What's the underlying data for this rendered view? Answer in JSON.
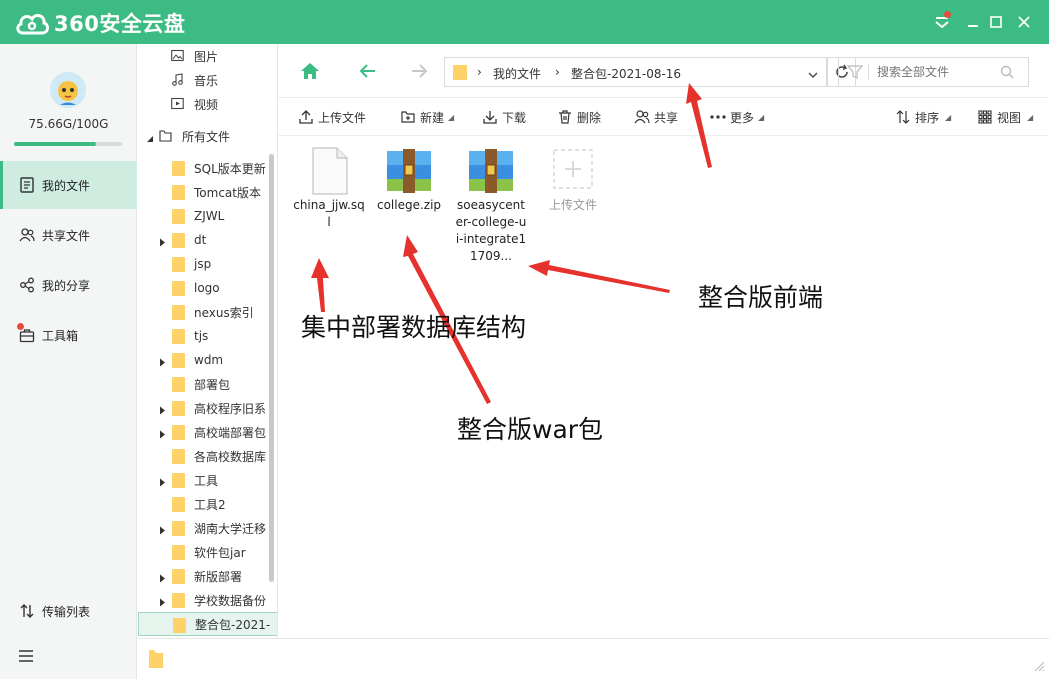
{
  "app": {
    "title": "360安全云盘"
  },
  "window_controls": {
    "menu": "menu-icon",
    "minimize": "minimize-icon",
    "maximize": "maximize-icon",
    "close": "close-icon"
  },
  "user": {
    "quota_text": "75.66G/100G",
    "quota_fraction": 0.7566
  },
  "nav": {
    "items": [
      {
        "label": "我的文件",
        "icon": "file-icon"
      },
      {
        "label": "共享文件",
        "icon": "people-icon"
      },
      {
        "label": "我的分享",
        "icon": "share-icon"
      },
      {
        "label": "工具箱",
        "icon": "toolbox-icon"
      }
    ],
    "transfer_label": "传输列表",
    "menu_icon": "hamburger-icon"
  },
  "tree": {
    "top_items": [
      {
        "label": "图片",
        "icon": "image-icon"
      },
      {
        "label": "音乐",
        "icon": "music-icon"
      },
      {
        "label": "视频",
        "icon": "video-icon"
      }
    ],
    "root_label": "所有文件",
    "folders": [
      {
        "label": "SQL版本更新",
        "expandable": false
      },
      {
        "label": "Tomcat版本",
        "expandable": false
      },
      {
        "label": "ZJWL",
        "expandable": false
      },
      {
        "label": "dt",
        "expandable": true
      },
      {
        "label": "jsp",
        "expandable": false
      },
      {
        "label": "logo",
        "expandable": false
      },
      {
        "label": "nexus索引",
        "expandable": false
      },
      {
        "label": "tjs",
        "expandable": false
      },
      {
        "label": "wdm",
        "expandable": true
      },
      {
        "label": "部署包",
        "expandable": false
      },
      {
        "label": "高校程序旧系",
        "expandable": true
      },
      {
        "label": "高校端部署包",
        "expandable": true
      },
      {
        "label": "各高校数据库",
        "expandable": false
      },
      {
        "label": "工具",
        "expandable": true
      },
      {
        "label": "工具2",
        "expandable": false
      },
      {
        "label": "湖南大学迁移",
        "expandable": true
      },
      {
        "label": "软件包jar",
        "expandable": false
      },
      {
        "label": "新版部署",
        "expandable": true
      },
      {
        "label": "学校数据备份",
        "expandable": true
      },
      {
        "label": "整合包-2021-",
        "expandable": false,
        "selected": true
      }
    ]
  },
  "address": {
    "breadcrumbs": [
      "我的文件",
      "整合包-2021-08-16"
    ],
    "search_placeholder": "搜索全部文件"
  },
  "toolbar": {
    "upload": "上传文件",
    "new": "新建",
    "download": "下载",
    "delete": "删除",
    "share": "共享",
    "more": "更多",
    "sort": "排序",
    "view": "视图"
  },
  "files": [
    {
      "name": "china_jjw.sql",
      "type": "sql"
    },
    {
      "name": "college.zip",
      "type": "zip"
    },
    {
      "name": "soeasycenter-college-ui-integrate11709...",
      "type": "zip"
    }
  ],
  "upload_tile": {
    "label": "上传文件"
  },
  "annotations": {
    "db": "集中部署数据库结构",
    "war": "整合版war包",
    "frontend": "整合版前端"
  },
  "colors": {
    "brand": "#3dbb85",
    "folder": "#fdd268",
    "arrow": "#e5322d"
  }
}
